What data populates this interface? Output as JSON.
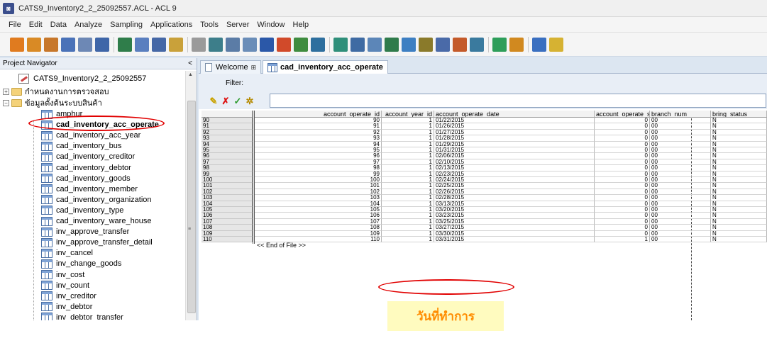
{
  "window": {
    "title": "CATS9_Inventory2_2_25092557.ACL - ACL 9"
  },
  "menu": [
    "File",
    "Edit",
    "Data",
    "Analyze",
    "Sampling",
    "Applications",
    "Tools",
    "Server",
    "Window",
    "Help"
  ],
  "toolbar_icons": [
    {
      "name": "open-project-icon",
      "color": "#e07b1f"
    },
    {
      "name": "open-table-icon",
      "color": "#d98a25"
    },
    {
      "name": "close-table-icon",
      "color": "#c7772a"
    },
    {
      "name": "save-icon",
      "color": "#4a72b8"
    },
    {
      "name": "print-icon",
      "color": "#6d88b5"
    },
    {
      "name": "properties-icon",
      "color": "#3f66a8"
    },
    {
      "name": "filter-icon",
      "color": "#2f7d4a"
    },
    {
      "name": "table-view-icon",
      "color": "#5a7fbf"
    },
    {
      "name": "chart-icon",
      "color": "#4668a6"
    },
    {
      "name": "new-document-icon",
      "color": "#c9a13a"
    },
    {
      "name": "edit-icon",
      "color": "#9a9a9a"
    },
    {
      "name": "table-layout-icon",
      "color": "#3d7e8a"
    },
    {
      "name": "view-icon",
      "color": "#5b7ca6"
    },
    {
      "name": "overview-icon",
      "color": "#6a8db8"
    },
    {
      "name": "search-icon",
      "color": "#2b58a8"
    },
    {
      "name": "statistics-icon",
      "color": "#d14a2a"
    },
    {
      "name": "bar-chart-icon",
      "color": "#3f8c3f"
    },
    {
      "name": "pie-icon",
      "color": "#2e6f9e"
    },
    {
      "name": "percent-icon",
      "color": "#2f8f7a"
    },
    {
      "name": "tree-icon",
      "color": "#3f6ba3"
    },
    {
      "name": "columns-icon",
      "color": "#5c86b8"
    },
    {
      "name": "join-icon",
      "color": "#2f7b4b"
    },
    {
      "name": "sequence-icon",
      "color": "#3d7fc2"
    },
    {
      "name": "classify-icon",
      "color": "#8a7a2a"
    },
    {
      "name": "age-icon",
      "color": "#4a6aa8"
    },
    {
      "name": "summarize-icon",
      "color": "#c45a2a"
    },
    {
      "name": "script-icon",
      "color": "#3a7a9e"
    },
    {
      "name": "run-icon",
      "color": "#2e9e5a"
    },
    {
      "name": "workspace-icon",
      "color": "#d1891f"
    },
    {
      "name": "layout-icon",
      "color": "#3a6fc0"
    },
    {
      "name": "help-icon",
      "color": "#d6b232"
    }
  ],
  "navigator": {
    "title": "Project Navigator",
    "collapse": "<",
    "project_name": "CATS9_Inventory2_2_25092557",
    "folder_1": "กำหนดงานการตรวจสอบ",
    "folder_2": "ข้อมูลตั้งต้นระบบสินค้า",
    "items": [
      "amphur",
      "cad_inventory_acc_operate",
      "cad_inventory_acc_year",
      "cad_inventory_bus",
      "cad_inventory_creditor",
      "cad_inventory_debtor",
      "cad_inventory_goods",
      "cad_inventory_member",
      "cad_inventory_organization",
      "cad_inventory_type",
      "cad_inventory_ware_house",
      "inv_approve_transfer",
      "inv_approve_transfer_detail",
      "inv_cancel",
      "inv_change_goods",
      "inv_cost",
      "inv_count",
      "inv_creditor",
      "inv_debtor",
      "inv_debtor_transfer"
    ]
  },
  "tabs": {
    "welcome": "Welcome",
    "active": "cad_inventory_acc_operate"
  },
  "filter": {
    "label": "Filter:",
    "value": ""
  },
  "grid": {
    "columns": [
      "account_operate_id",
      "account_year_id",
      "account_operate_date",
      "account_operate_status",
      "branch_num",
      "bring_status"
    ],
    "rows": [
      [
        "90",
        "90",
        "1",
        "01/22/2015",
        "0",
        "00",
        "N"
      ],
      [
        "91",
        "91",
        "1",
        "01/26/2015",
        "0",
        "00",
        "N"
      ],
      [
        "92",
        "92",
        "1",
        "01/27/2015",
        "0",
        "00",
        "N"
      ],
      [
        "93",
        "93",
        "1",
        "01/28/2015",
        "0",
        "00",
        "N"
      ],
      [
        "94",
        "94",
        "1",
        "01/29/2015",
        "0",
        "00",
        "N"
      ],
      [
        "95",
        "95",
        "1",
        "01/31/2015",
        "0",
        "00",
        "N"
      ],
      [
        "96",
        "96",
        "1",
        "02/06/2015",
        "0",
        "00",
        "N"
      ],
      [
        "97",
        "97",
        "1",
        "02/10/2015",
        "0",
        "00",
        "N"
      ],
      [
        "98",
        "98",
        "1",
        "02/13/2015",
        "0",
        "00",
        "N"
      ],
      [
        "99",
        "99",
        "1",
        "02/23/2015",
        "0",
        "00",
        "N"
      ],
      [
        "100",
        "100",
        "1",
        "02/24/2015",
        "0",
        "00",
        "N"
      ],
      [
        "101",
        "101",
        "1",
        "02/25/2015",
        "0",
        "00",
        "N"
      ],
      [
        "102",
        "102",
        "1",
        "02/26/2015",
        "0",
        "00",
        "N"
      ],
      [
        "103",
        "103",
        "1",
        "02/28/2015",
        "0",
        "00",
        "N"
      ],
      [
        "104",
        "104",
        "1",
        "03/13/2015",
        "0",
        "00",
        "N"
      ],
      [
        "105",
        "105",
        "1",
        "03/20/2015",
        "0",
        "00",
        "N"
      ],
      [
        "106",
        "106",
        "1",
        "03/23/2015",
        "0",
        "00",
        "N"
      ],
      [
        "107",
        "107",
        "1",
        "03/25/2015",
        "0",
        "00",
        "N"
      ],
      [
        "108",
        "108",
        "1",
        "03/27/2015",
        "0",
        "00",
        "N"
      ],
      [
        "109",
        "109",
        "1",
        "03/30/2015",
        "0",
        "00",
        "N"
      ],
      [
        "110",
        "110",
        "1",
        "03/31/2015",
        "1",
        "00",
        "N"
      ]
    ],
    "end_of_file": "<< End of File >>"
  },
  "annotation": {
    "text": "วันที่ทำการ",
    "highlight_color": "#e10000"
  }
}
